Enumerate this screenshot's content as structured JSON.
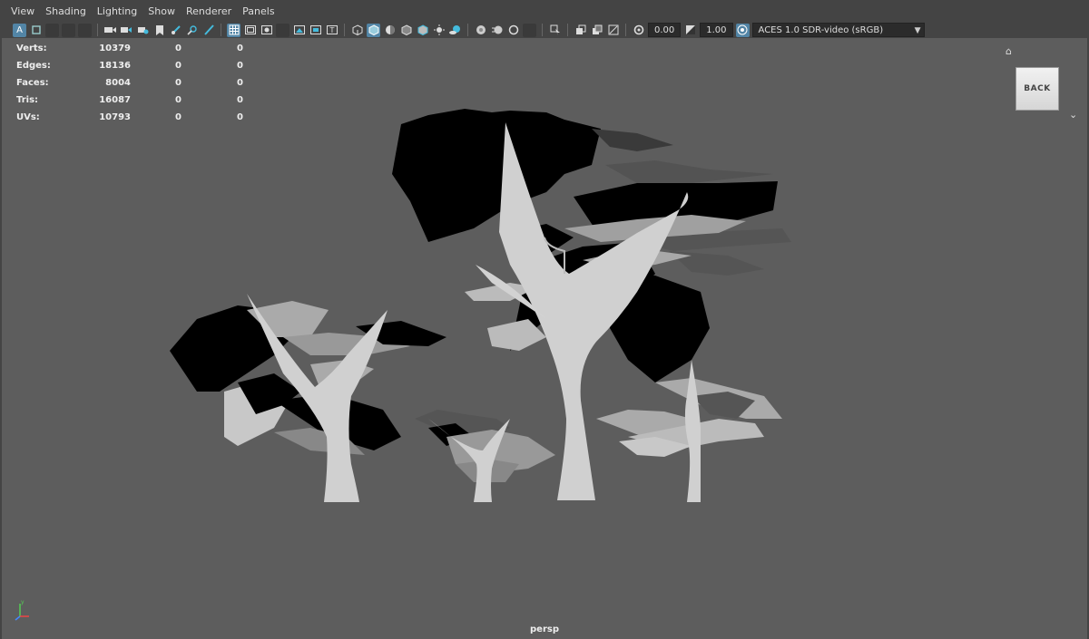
{
  "menubar": {
    "items": [
      {
        "label": "View"
      },
      {
        "label": "Shading"
      },
      {
        "label": "Lighting"
      },
      {
        "label": "Show"
      },
      {
        "label": "Renderer"
      },
      {
        "label": "Panels"
      }
    ]
  },
  "toolbar": {
    "exposure_value": "0.00",
    "gamma_value": "1.00",
    "color_space": "ACES 1.0 SDR-video (sRGB)",
    "first_button_label": "A"
  },
  "hud": {
    "stats": [
      {
        "label": "Verts:",
        "value": "10379",
        "c1": "0",
        "c2": "0"
      },
      {
        "label": "Edges:",
        "value": "18136",
        "c1": "0",
        "c2": "0"
      },
      {
        "label": "Faces:",
        "value": "8004",
        "c1": "0",
        "c2": "0"
      },
      {
        "label": "Tris:",
        "value": "16087",
        "c1": "0",
        "c2": "0"
      },
      {
        "label": "UVs:",
        "value": "10793",
        "c1": "0",
        "c2": "0"
      }
    ]
  },
  "viewcube": {
    "label": "BACK"
  },
  "camera": {
    "name": "persp"
  },
  "colors": {
    "viewport_bg": "#5d5d5d",
    "accent": "#5285a6"
  }
}
